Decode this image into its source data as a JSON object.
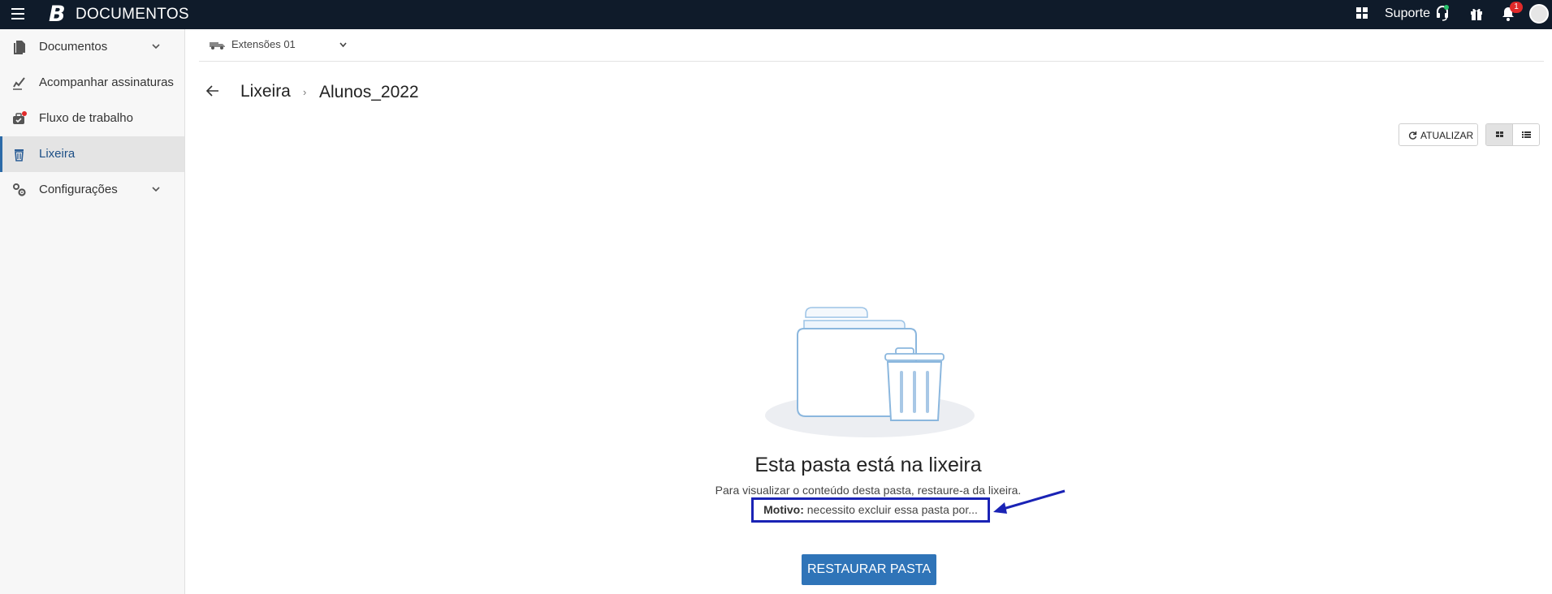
{
  "app": {
    "logo_letter": "B",
    "title": "DOCUMENTOS"
  },
  "topbar": {
    "support_label": "Suporte",
    "notification_count": "1",
    "icons": [
      "menu-icon",
      "apps-grid-icon",
      "headset-icon",
      "gift-icon",
      "bell-icon",
      "avatar"
    ]
  },
  "sidebar": {
    "items": [
      {
        "label": "Documentos",
        "icon": "documents-icon",
        "has_chevron": true
      },
      {
        "label": "Acompanhar assinaturas",
        "icon": "signature-icon",
        "has_chevron": false
      },
      {
        "label": "Fluxo de trabalho",
        "icon": "workflow-briefcase-icon",
        "has_chevron": false
      },
      {
        "label": "Lixeira",
        "icon": "trash-icon",
        "active": true
      },
      {
        "label": "Configurações",
        "icon": "settings-gears-icon",
        "has_chevron": true
      }
    ]
  },
  "subbar": {
    "extension_label": "Extensões 01"
  },
  "breadcrumb": {
    "parent": "Lixeira",
    "separator": "›",
    "current": "Alunos_2022"
  },
  "toolbar": {
    "refresh_label": "ATUALIZAR",
    "view_modes": [
      "grid",
      "list"
    ],
    "selected_view": "grid"
  },
  "empty_state": {
    "title": "Esta pasta está na lixeira",
    "description": "Para visualizar o conteúdo desta pasta, restaure-a da lixeira.",
    "reason_label": "Motivo:",
    "reason_text": "necessito excluir essa pasta por...",
    "restore_button": "RESTAURAR PASTA"
  },
  "colors": {
    "topbar_bg": "#0f1b2a",
    "accent_blue": "#2f74b8",
    "annotation_blue": "#1a23b5",
    "notification_red": "#e02a2a",
    "support_online_green": "#27c26c"
  }
}
